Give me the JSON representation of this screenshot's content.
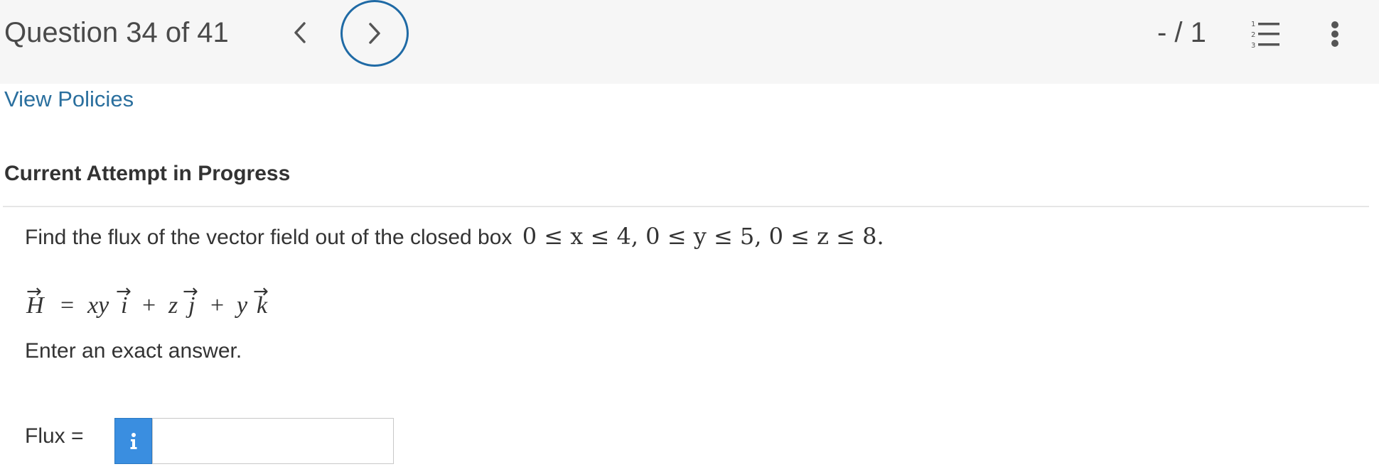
{
  "header": {
    "question_label": "Question 34 of 41",
    "score": "- / 1",
    "prev_icon": "chevron-left-icon",
    "next_icon": "chevron-right-icon",
    "list_icon": "numbered-list-icon",
    "more_icon": "vertical-ellipsis-icon"
  },
  "links": {
    "policies": "View Policies"
  },
  "attempt_heading": "Current Attempt in Progress",
  "question": {
    "prompt": "Find the flux of the vector field out of the closed box",
    "bounds": "0 ≤ x ≤ 4, 0 ≤ y ≤ 5, 0 ≤ z ≤ 8.",
    "field": {
      "lhs": "H",
      "eq": "=",
      "t1_coef": "xy",
      "t1_unit": "i",
      "plus1": "+",
      "t2_coef": "z",
      "t2_unit": "j",
      "plus2": "+",
      "t3_coef": "y",
      "t3_unit": "k",
      "arrow": "→"
    },
    "instruction": "Enter an exact answer."
  },
  "answer": {
    "label": "Flux =",
    "info_glyph": "i",
    "value": "",
    "placeholder": ""
  },
  "colors": {
    "accent": "#1f6aa5",
    "link": "#2a6f9e",
    "info_button": "#3a8ee0",
    "header_bg": "#f6f6f6"
  }
}
